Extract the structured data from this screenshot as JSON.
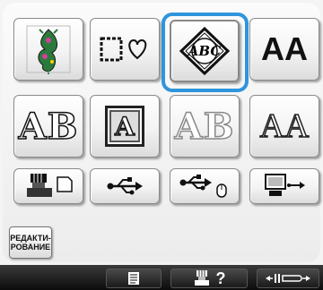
{
  "categories": [
    {
      "name": "decorative-pattern",
      "icon": "paisley-flower-icon"
    },
    {
      "name": "frame-shapes",
      "icon": "frame-shapes-icon"
    },
    {
      "name": "monogram",
      "icon": "monogram-abc-icon",
      "text": "ABC",
      "selected": true
    },
    {
      "name": "gothic-font",
      "text": "AA"
    },
    {
      "name": "serif-font",
      "text": "AB"
    },
    {
      "name": "floral-letter",
      "text": "A"
    },
    {
      "name": "outline-font",
      "text": "AB"
    },
    {
      "name": "alphabet-outline-font",
      "text": "AA"
    },
    {
      "name": "embroidery-machine-memory",
      "icon": "machine-memory-icon"
    },
    {
      "name": "usb-media",
      "icon": "usb-icon"
    },
    {
      "name": "usb-mouse",
      "icon": "usb-mouse-icon"
    },
    {
      "name": "computer",
      "icon": "computer-usb-icon"
    }
  ],
  "edit_button": {
    "line1": "РЕДАКТИ-",
    "line2": "РОВАНИЕ"
  },
  "bottom_bar": {
    "buttons": [
      {
        "name": "list-button",
        "icon": "list-icon"
      },
      {
        "name": "help-button",
        "icon": "machine-help-icon",
        "label": "?"
      },
      {
        "name": "needle-position-button",
        "icon": "needle-move-icon"
      }
    ]
  },
  "colors": {
    "selection": "#2f95dc",
    "bar": "#1a1a1a"
  }
}
